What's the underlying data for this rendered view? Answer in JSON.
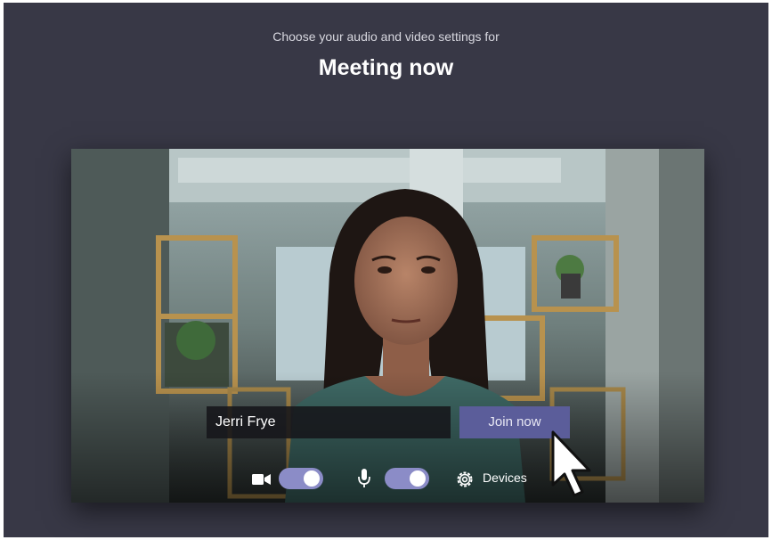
{
  "header": {
    "subtitle": "Choose your audio and video settings for",
    "meeting_title": "Meeting now"
  },
  "join_bar": {
    "name_value": "Jerri Frye",
    "join_label": "Join now"
  },
  "controls": {
    "camera_toggle_on": true,
    "mic_toggle_on": true,
    "devices_label": "Devices"
  },
  "colors": {
    "background": "#383846",
    "accent": "#5b5d9a",
    "toggle_on": "#8b8cc7"
  },
  "icons": [
    "video-camera-icon",
    "microphone-icon",
    "gear-icon",
    "mouse-cursor-icon"
  ]
}
